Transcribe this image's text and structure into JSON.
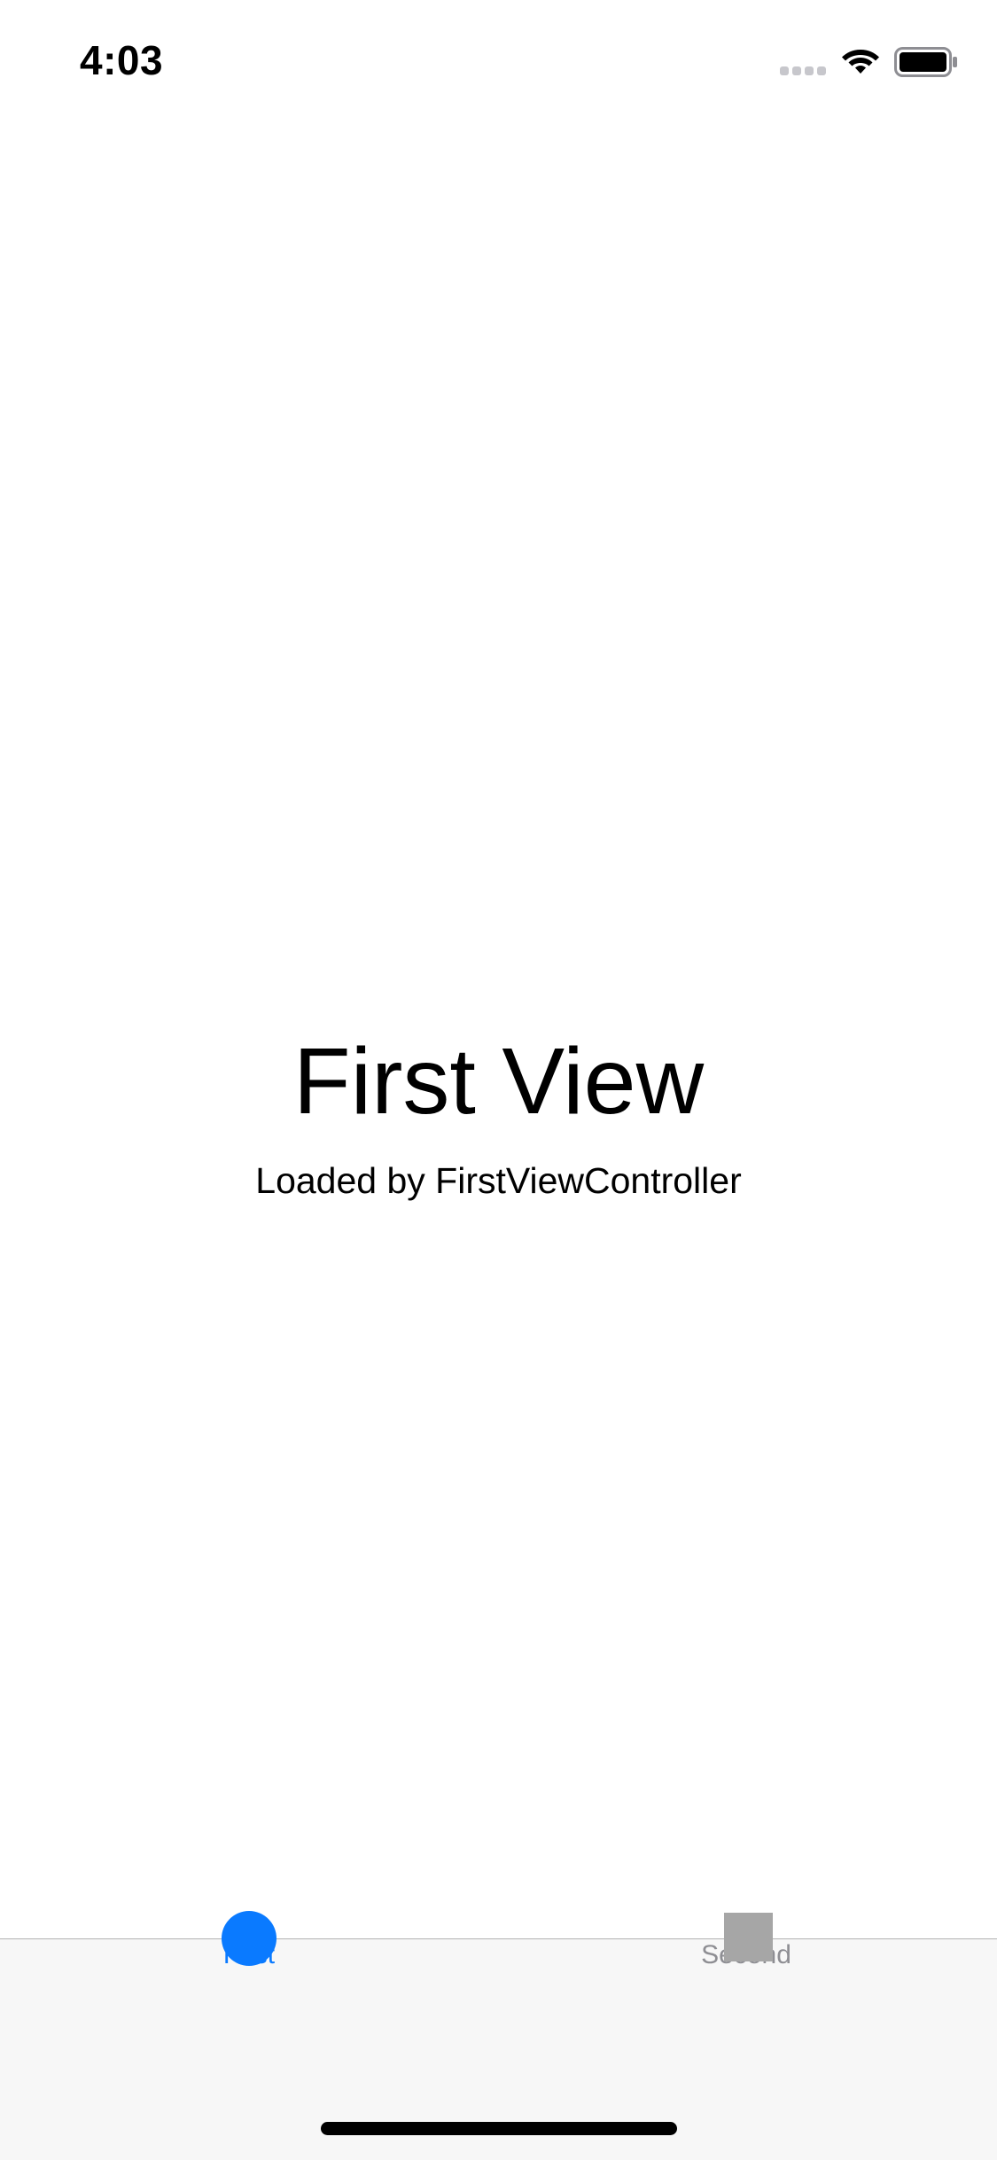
{
  "status_bar": {
    "time": "4:03",
    "icons": [
      "signal-icon",
      "wifi-icon",
      "battery-icon"
    ]
  },
  "main": {
    "title": "First View",
    "subtitle": "Loaded by FirstViewController"
  },
  "tab_bar": {
    "selected": "First",
    "tabs": [
      {
        "label": "First",
        "icon": "circle-icon",
        "color": "#0a7aff"
      },
      {
        "label": "Second",
        "icon": "square-icon",
        "color": "#8e8e93"
      }
    ]
  }
}
